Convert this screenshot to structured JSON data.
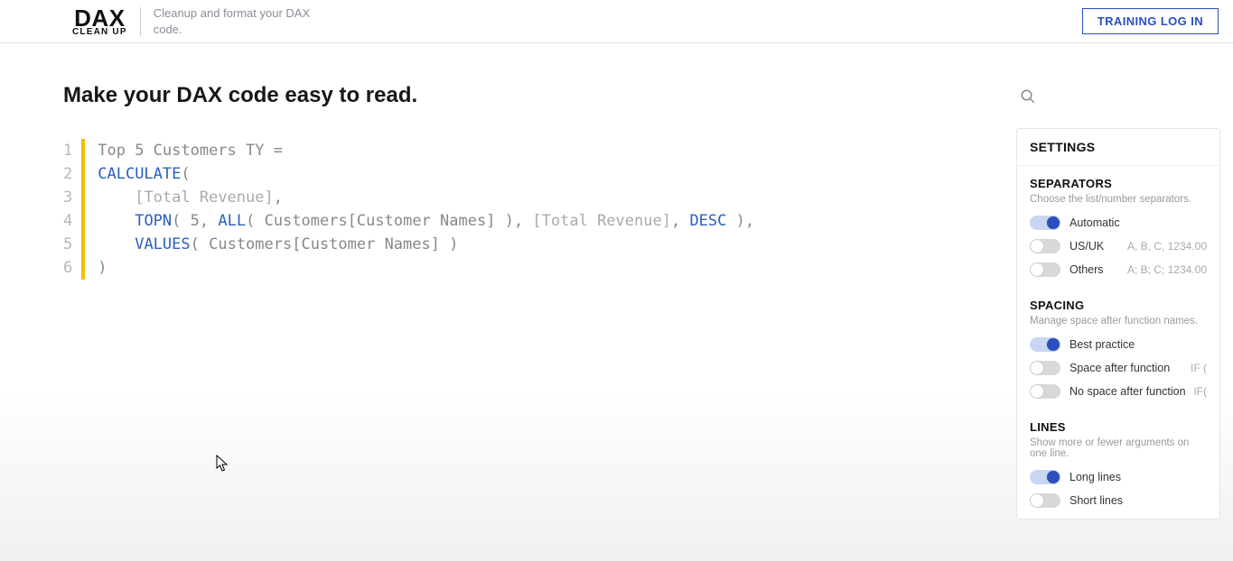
{
  "header": {
    "logo_main": "DAX",
    "logo_sub": "CLEAN UP",
    "tagline": "Cleanup and format your DAX code.",
    "login_label": "TRAINING LOG IN"
  },
  "page_title": "Make your DAX code easy to read.",
  "code": {
    "line_numbers": [
      "1",
      "2",
      "3",
      "4",
      "5",
      "6"
    ],
    "lines": [
      [
        {
          "t": "Top 5 Customers TY ",
          "c": "tok-text"
        },
        {
          "t": "=",
          "c": "tok-op"
        }
      ],
      [
        {
          "t": "CALCULATE",
          "c": "tok-key"
        },
        {
          "t": "(",
          "c": "tok-par"
        }
      ],
      [
        {
          "t": "    ",
          "c": "tok-text"
        },
        {
          "t": "[Total Revenue]",
          "c": "tok-br"
        },
        {
          "t": ",",
          "c": "tok-par"
        }
      ],
      [
        {
          "t": "    ",
          "c": "tok-text"
        },
        {
          "t": "TOPN",
          "c": "tok-key"
        },
        {
          "t": "( ",
          "c": "tok-par"
        },
        {
          "t": "5",
          "c": "tok-num"
        },
        {
          "t": ", ",
          "c": "tok-par"
        },
        {
          "t": "ALL",
          "c": "tok-key"
        },
        {
          "t": "( ",
          "c": "tok-par"
        },
        {
          "t": "Customers[Customer Names]",
          "c": "tok-id"
        },
        {
          "t": " )",
          "c": "tok-par"
        },
        {
          "t": ", ",
          "c": "tok-par"
        },
        {
          "t": "[Total Revenue]",
          "c": "tok-br"
        },
        {
          "t": ", ",
          "c": "tok-par"
        },
        {
          "t": "DESC",
          "c": "tok-key"
        },
        {
          "t": " )",
          "c": "tok-par"
        },
        {
          "t": ",",
          "c": "tok-par"
        }
      ],
      [
        {
          "t": "    ",
          "c": "tok-text"
        },
        {
          "t": "VALUES",
          "c": "tok-key"
        },
        {
          "t": "( ",
          "c": "tok-par"
        },
        {
          "t": "Customers[Customer Names]",
          "c": "tok-id"
        },
        {
          "t": " )",
          "c": "tok-par"
        }
      ],
      [
        {
          "t": ")",
          "c": "tok-par"
        }
      ]
    ]
  },
  "settings": {
    "panel_title": "SETTINGS",
    "separators": {
      "title": "SEPARATORS",
      "desc": "Choose the list/number separators.",
      "options": [
        {
          "label": "Automatic",
          "on": true,
          "hint": ""
        },
        {
          "label": "US/UK",
          "on": false,
          "hint": "A, B, C, 1234.00"
        },
        {
          "label": "Others",
          "on": false,
          "hint": "A; B; C; 1234.00"
        }
      ]
    },
    "spacing": {
      "title": "SPACING",
      "desc": "Manage space after function names.",
      "options": [
        {
          "label": "Best practice",
          "on": true,
          "hint": ""
        },
        {
          "label": "Space after function",
          "on": false,
          "hint": "IF ("
        },
        {
          "label": "No space after function",
          "on": false,
          "hint": "IF("
        }
      ]
    },
    "lines": {
      "title": "LINES",
      "desc": "Show more or fewer arguments on one line.",
      "options": [
        {
          "label": "Long lines",
          "on": true,
          "hint": ""
        },
        {
          "label": "Short lines",
          "on": false,
          "hint": ""
        }
      ]
    }
  }
}
